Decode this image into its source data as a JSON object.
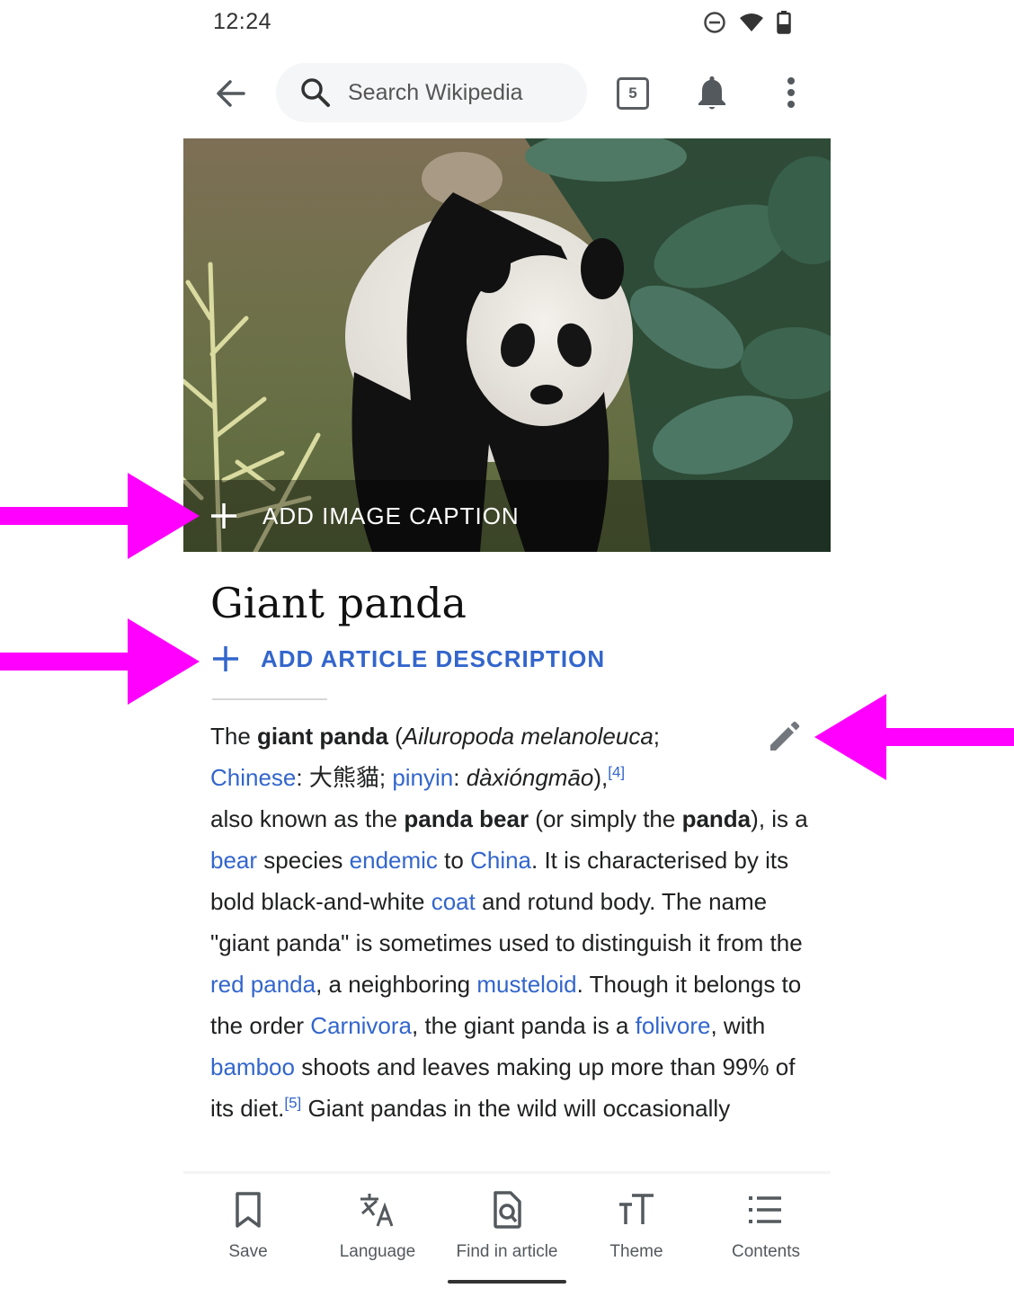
{
  "status_bar": {
    "time": "12:24",
    "icons": [
      "do-not-disturb-icon",
      "wifi-icon",
      "battery-icon"
    ]
  },
  "toolbar": {
    "back_icon": "arrow-left-icon",
    "search_placeholder": "Search Wikipedia",
    "search_icon": "search-icon",
    "tab_count": "5",
    "notifications_icon": "bell-icon",
    "overflow_icon": "more-vertical-icon"
  },
  "lead_image": {
    "subject": "Giant panda photo",
    "caption_action_label": "ADD IMAGE CAPTION"
  },
  "article": {
    "title": "Giant panda",
    "add_description_label": "ADD ARTICLE DESCRIPTION",
    "edit_icon": "pencil-icon",
    "paragraph": [
      {
        "t": "text",
        "v": "The "
      },
      {
        "t": "bold",
        "v": "giant panda"
      },
      {
        "t": "text",
        "v": " ("
      },
      {
        "t": "italic",
        "v": "Ailuropoda melanoleuca"
      },
      {
        "t": "text",
        "v": ";"
      },
      {
        "t": "br"
      },
      {
        "t": "link",
        "v": "Chinese"
      },
      {
        "t": "text",
        "v": ": 大熊貓; "
      },
      {
        "t": "link",
        "v": "pinyin"
      },
      {
        "t": "text",
        "v": ": "
      },
      {
        "t": "italic",
        "v": "dàxióngmāo"
      },
      {
        "t": "text",
        "v": "),"
      },
      {
        "t": "ref",
        "v": "[4]"
      },
      {
        "t": "br"
      },
      {
        "t": "text",
        "v": "also known as the "
      },
      {
        "t": "bold",
        "v": "panda bear"
      },
      {
        "t": "text",
        "v": " (or simply the "
      },
      {
        "t": "bold",
        "v": "panda"
      },
      {
        "t": "text",
        "v": "), is a "
      },
      {
        "t": "link",
        "v": "bear"
      },
      {
        "t": "text",
        "v": " species "
      },
      {
        "t": "link",
        "v": "endemic"
      },
      {
        "t": "text",
        "v": " to "
      },
      {
        "t": "link",
        "v": "China"
      },
      {
        "t": "text",
        "v": ". It is characterised by its bold black-and-white "
      },
      {
        "t": "link",
        "v": "coat"
      },
      {
        "t": "text",
        "v": " and rotund body. The name \"giant panda\" is sometimes used to distinguish it from the "
      },
      {
        "t": "link",
        "v": "red panda"
      },
      {
        "t": "text",
        "v": ", a neighboring "
      },
      {
        "t": "link",
        "v": "musteloid"
      },
      {
        "t": "text",
        "v": ". Though it belongs to the order "
      },
      {
        "t": "link",
        "v": "Carnivora"
      },
      {
        "t": "text",
        "v": ", the giant panda is a "
      },
      {
        "t": "link",
        "v": "folivore"
      },
      {
        "t": "text",
        "v": ", with "
      },
      {
        "t": "link",
        "v": "bamboo"
      },
      {
        "t": "text",
        "v": " shoots and leaves making up more than 99% of its diet."
      },
      {
        "t": "ref",
        "v": "[5]"
      },
      {
        "t": "text",
        "v": " Giant pandas in the wild will occasionally"
      }
    ]
  },
  "bottom_bar": {
    "items": [
      {
        "label": "Save",
        "icon": "bookmark-icon"
      },
      {
        "label": "Language",
        "icon": "translate-icon"
      },
      {
        "label": "Find in article",
        "icon": "find-in-page-icon"
      },
      {
        "label": "Theme",
        "icon": "text-size-icon"
      },
      {
        "label": "Contents",
        "icon": "list-icon"
      }
    ]
  },
  "annotations": {
    "arrow_color": "#ff00ff",
    "targets": [
      "add-image-caption-button",
      "add-article-description-button",
      "edit-section-button"
    ]
  },
  "colors": {
    "link": "#3366cc",
    "icon_gray": "#5a5d61",
    "search_bg": "#f5f6f7"
  }
}
